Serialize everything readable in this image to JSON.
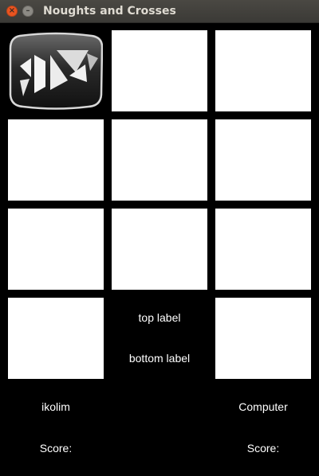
{
  "window": {
    "title": "Noughts and Crosses",
    "close_glyph": "×",
    "minimize_glyph": "–"
  },
  "board": {
    "logo_icon": "kivy-logo-icon",
    "cells": [
      "",
      "",
      "",
      "",
      "",
      "",
      "",
      "",
      "",
      "",
      ""
    ]
  },
  "center": {
    "top_label": "top label",
    "bottom_label": "bottom label"
  },
  "players": {
    "left_name": "ikolim",
    "left_score_label": "Score:",
    "right_name": "Computer",
    "right_score_label": "Score:"
  },
  "colors": {
    "background": "#000000",
    "cell": "#ffffff",
    "titlebar": "#3c3b37",
    "close_button": "#e95420"
  }
}
